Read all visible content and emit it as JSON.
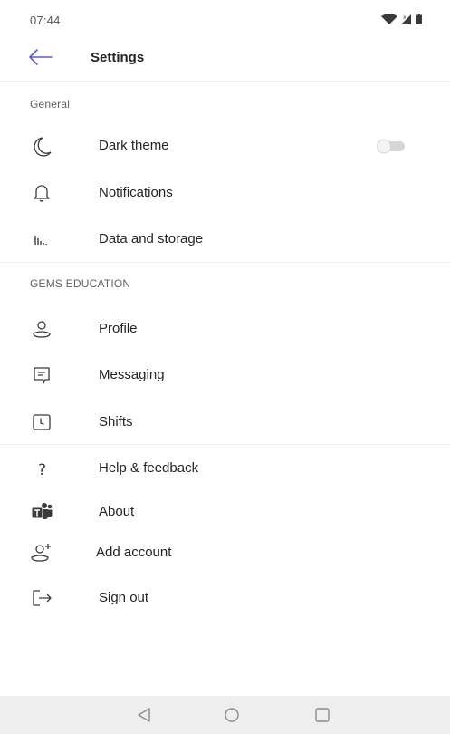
{
  "status_bar": {
    "time": "07:44"
  },
  "header": {
    "title": "Settings"
  },
  "sections": {
    "general": {
      "title": "General",
      "items": [
        {
          "label": "Dark theme",
          "icon": "moon-icon",
          "toggle": false
        },
        {
          "label": "Notifications",
          "icon": "bell-icon"
        },
        {
          "label": "Data and storage",
          "icon": "bar-chart-icon"
        }
      ]
    },
    "org": {
      "title": "GEMS EDUCATION",
      "items": [
        {
          "label": "Profile",
          "icon": "profile-icon"
        },
        {
          "label": "Messaging",
          "icon": "message-icon"
        },
        {
          "label": "Shifts",
          "icon": "clock-icon"
        }
      ]
    },
    "other": {
      "items": [
        {
          "label": "Help & feedback",
          "icon": "help-icon"
        },
        {
          "label": "About",
          "icon": "teams-logo-icon"
        },
        {
          "label": "Add account",
          "icon": "add-account-icon"
        },
        {
          "label": "Sign out",
          "icon": "sign-out-icon"
        }
      ]
    }
  },
  "colors": {
    "accent": "#5b5fc7",
    "text": "#242424",
    "muted": "#616161",
    "nav_bar": "#eeeeee"
  }
}
